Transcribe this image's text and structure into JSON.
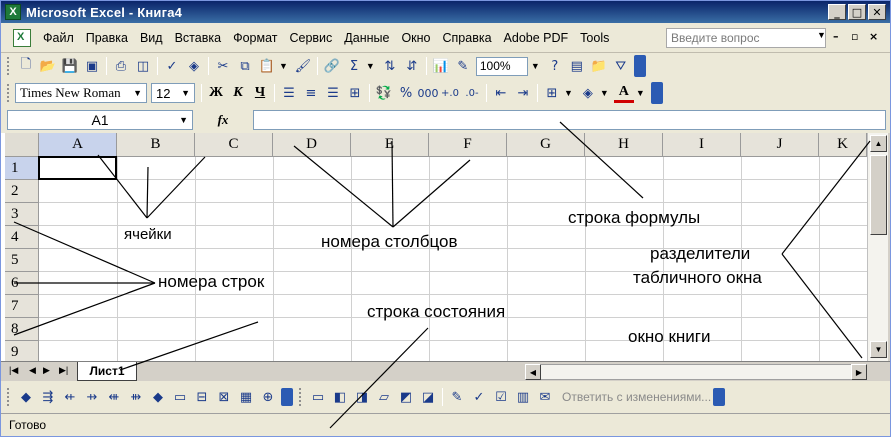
{
  "window": {
    "title": "Microsoft Excel - Книга4",
    "app_icon_letter": "X"
  },
  "menu": {
    "items": [
      "Файл",
      "Правка",
      "Вид",
      "Вставка",
      "Формат",
      "Сервис",
      "Данные",
      "Окно",
      "Справка",
      "Adobe PDF",
      "Tools"
    ],
    "help_placeholder": "Введите вопрос"
  },
  "toolbar": {
    "zoom": "100%",
    "font_name": "Times New Roman",
    "font_size": "12",
    "bold": "Ж",
    "italic": "К",
    "underline": "Ч",
    "percent": "%",
    "thousands": "000",
    "autosum": "Σ"
  },
  "formula_bar": {
    "name_box": "A1",
    "fx": "fx"
  },
  "grid": {
    "columns": [
      "A",
      "B",
      "C",
      "D",
      "E",
      "F",
      "G",
      "H",
      "I",
      "J",
      "K"
    ],
    "rows": [
      "1",
      "2",
      "3",
      "4",
      "5",
      "6",
      "7",
      "8",
      "9"
    ],
    "active_cell": "A1"
  },
  "sheets": {
    "tabs": [
      "Лист1"
    ]
  },
  "review_toolbar": {
    "reply_label": "Ответить с изменениями..."
  },
  "status": {
    "text": "Готово"
  },
  "annotations": {
    "cells": "ячейки",
    "column_numbers": "номера столбцов",
    "formula_row": "строка формулы",
    "separators_line1": "разделители",
    "separators_line2": "табличного окна",
    "row_numbers": "номера строк",
    "status_row": "строка состояния",
    "book_window": "окно книги"
  }
}
